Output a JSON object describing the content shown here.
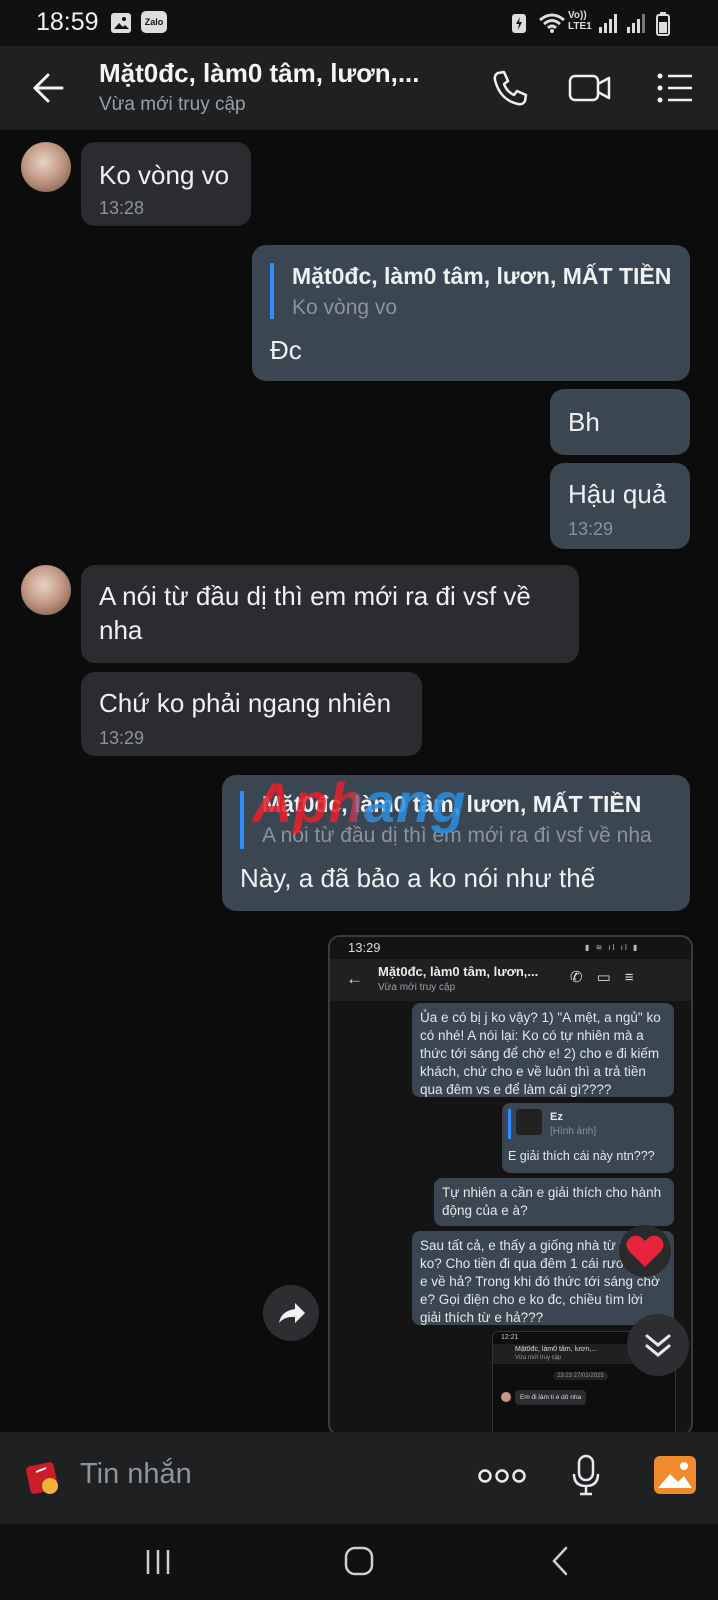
{
  "status": {
    "time": "18:59",
    "zalo_badge": "Zalo",
    "volte": "Vo)) LTE1"
  },
  "header": {
    "title": "Mặt0đc, làm0 tâm, lươn,...",
    "subtitle": "Vừa mới truy cập"
  },
  "messages": {
    "m1": {
      "text": "Ko vòng vo",
      "time": "13:28"
    },
    "m2": {
      "quote_name": "Mặt0đc, làm0 tâm, lươn, MẤT TIỀN",
      "quote_text": "Ko vòng vo",
      "text": "Đc"
    },
    "m3": {
      "text": "Bh"
    },
    "m4": {
      "text": "Hậu quả",
      "time": "13:29"
    },
    "m5": {
      "line1": "A nói từ đầu dị thì em mới ra đi vsf về",
      "line2": "nha"
    },
    "m6": {
      "text": "Chứ ko phải ngang nhiên",
      "time": "13:29"
    },
    "m7": {
      "quote_name": "Mặt0đc, làm0 tâm, lươn, MẤT TIỀN",
      "quote_text": "A nói từ đầu dị thì em mới ra đi vsf về nha",
      "text": "Này, a đã bảo a ko nói như thế"
    }
  },
  "watermark": "Aphang",
  "screenshot": {
    "time": "13:29",
    "title": "Mặt0đc, làm0 tâm, lươn,...",
    "subtitle": "Vừa mới truy cập",
    "b1": "Ủa e có bị j ko vậy? 1) \"A mệt, a ngủ\" ko có nhé! A nói lại: Ko có tự nhiên mà a thức tới sáng để chờ e! 2) cho e đi kiếm khách, chứ cho e về luôn thì a trả tiền qua đêm vs e để làm cái gì????",
    "b2_name": "Ez",
    "b2_sub": "[Hình ảnh]",
    "b2_text": "E giải thích cái này ntn???",
    "b3": "Tự nhiên a cần e giải thích cho hành động của e à?",
    "b4": "Sau tất cả, e thấy a giống nhà từ thiện ko? Cho tiền đi qua đêm 1 cái rươi r bảo e về hả? Trong khi đó thức tới sáng chờ e? Gọi điện cho e ko đc, chiều tìm lời giải thích từ e hả???",
    "inner": {
      "time": "12:21",
      "title": "Mặt0đc, làm0 tâm, lươn,...",
      "subtitle": "Vừa mới truy cập",
      "date": "23:23 27/01/2025",
      "msg": "Em đi làm ti e dô nha"
    }
  },
  "input": {
    "placeholder": "Tin nhắn"
  },
  "colors": {
    "accent": "#2f8cff",
    "outgoing": "#3a4652",
    "incoming": "#2b2c2f",
    "header": "#1f2022",
    "reaction": "#e8243a"
  }
}
